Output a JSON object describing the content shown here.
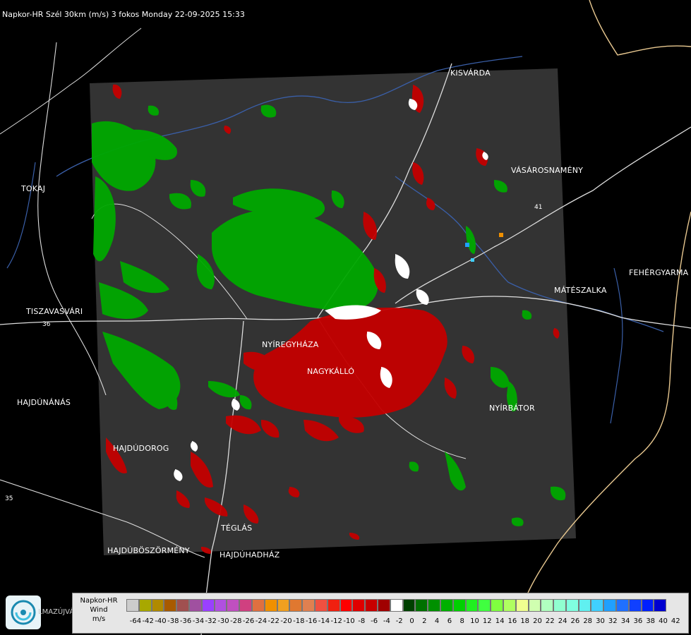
{
  "header": {
    "title": "Napkor-HR Szél 30km (m/s) 3 fokos Monday 22-09-2025 15:33"
  },
  "cities": [
    {
      "name": "KISVÁRDA"
    },
    {
      "name": "TOKAJ"
    },
    {
      "name": "VÁSÁROSNAMÉNY"
    },
    {
      "name": "FEHÉRGYARMA"
    },
    {
      "name": "MÁTÉSZALKA"
    },
    {
      "name": "TISZAVASVÁRI"
    },
    {
      "name": "NYÍREGYHÁZA"
    },
    {
      "name": "NAGYKÁLLÓ"
    },
    {
      "name": "HAJDÚNÁNÁS"
    },
    {
      "name": "NYÍRBÁTOR"
    },
    {
      "name": "HAJDÚDOROG"
    },
    {
      "name": "TÉGLÁS"
    },
    {
      "name": "HAJDÚBÖSZÖRMÉNY"
    },
    {
      "name": "HAJDÚHADHÁZ"
    }
  ],
  "road_numbers": [
    "41",
    "36",
    "35"
  ],
  "legend": {
    "title_line1": "Napkor-HR",
    "title_line2": "Wind",
    "unit": "m/s",
    "logo_text": "LMAZÚJVÁR",
    "tick_labels": [
      "-64",
      "-42",
      "-40",
      "-38",
      "-36",
      "-34",
      "-32",
      "-30",
      "-28",
      "-26",
      "-24",
      "-22",
      "-20",
      "-18",
      "-16",
      "-14",
      "-12",
      "-10",
      "-8",
      "-6",
      "-4",
      "-2",
      "0",
      "2",
      "4",
      "6",
      "8",
      "10",
      "12",
      "14",
      "16",
      "18",
      "20",
      "22",
      "24",
      "26",
      "28",
      "30",
      "32",
      "34",
      "36",
      "38",
      "40",
      "42"
    ],
    "colors": [
      "#cccccc",
      "#a8a800",
      "#b08a00",
      "#a85a00",
      "#a05050",
      "#a050a0",
      "#9a40ff",
      "#b050e0",
      "#c050c0",
      "#d04080",
      "#e07040",
      "#f09000",
      "#f0a020",
      "#e07830",
      "#e08050",
      "#f05040",
      "#f02010",
      "#ff0000",
      "#e00000",
      "#c80000",
      "#a00000",
      "#ffffff",
      "#004000",
      "#007000",
      "#009000",
      "#00b000",
      "#00d000",
      "#20f020",
      "#40ff40",
      "#80ff40",
      "#b0ff60",
      "#f0ff90",
      "#d0ffb0",
      "#b0ffc0",
      "#90ffd0",
      "#80ffe0",
      "#60f0f0",
      "#40d0ff",
      "#20a0ff",
      "#2070ff",
      "#1040ff",
      "#0020ff",
      "#0000d0"
    ]
  },
  "colors": {
    "background": "#000000",
    "radar_area": "#333333",
    "approaching": "#00b000",
    "receding": "#c00000",
    "border_line": "#e8c890"
  }
}
